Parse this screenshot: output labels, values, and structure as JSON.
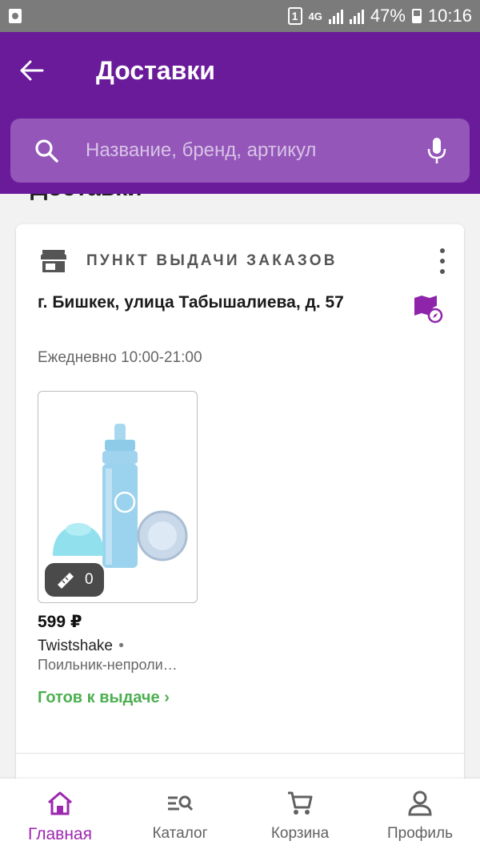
{
  "status_bar": {
    "sim": "1",
    "network": "4G",
    "battery": "47%",
    "time": "10:16"
  },
  "header": {
    "title": "Доставки"
  },
  "search": {
    "placeholder": "Название, бренд, артикул"
  },
  "section_title": "Доставки",
  "delivery": {
    "type_label": "ПУНКТ ВЫДАЧИ ЗАКАЗОВ",
    "address": "г. Бишкек, улица Табышалиева, д. 57",
    "hours": "Ежедневно 10:00-21:00",
    "item": {
      "size_count": "0",
      "price": "599 ₽",
      "brand": "Twistshake",
      "brand_separator": "•",
      "name": "Поильник-непроли…",
      "status": "Готов к выдаче ›"
    }
  },
  "colors": {
    "accent": "#6a1b9a",
    "search_bg": "#9456b9",
    "status_green": "#4caf50",
    "nav_active": "#9c27b0"
  },
  "nav": [
    {
      "label": "Главная",
      "icon": "home-icon",
      "active": true
    },
    {
      "label": "Каталог",
      "icon": "catalog-search-icon",
      "active": false
    },
    {
      "label": "Корзина",
      "icon": "cart-icon",
      "active": false
    },
    {
      "label": "Профиль",
      "icon": "profile-icon",
      "active": false
    }
  ]
}
